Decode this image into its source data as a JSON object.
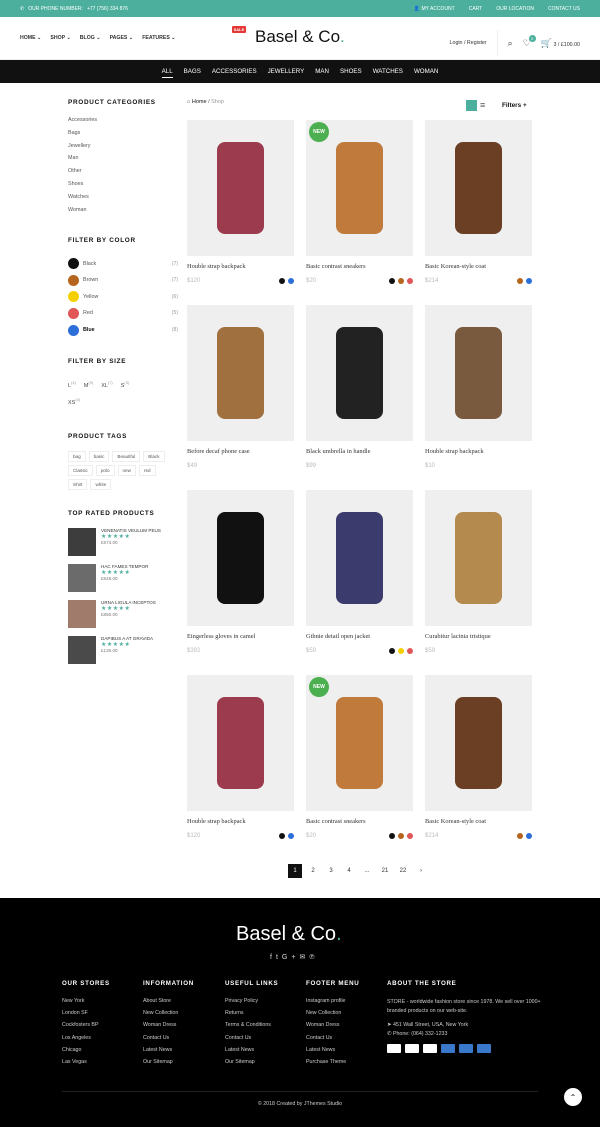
{
  "topbar": {
    "phone_label": "OUR PHONE NUMBER:",
    "phone_number": "+77 (756) 334 876",
    "my_account": "MY ACCOUNT",
    "cart": "CART",
    "our_location": "OUR LOCATION",
    "contact_us": "CONTACT US"
  },
  "nav": {
    "home": "HOME",
    "shop": "SHOP",
    "sale_badge": "SALE",
    "blog": "BLOG",
    "pages": "PAGES",
    "features": "FEATURES"
  },
  "logo": {
    "text": "Basel & Co",
    "dot": "."
  },
  "header_right": {
    "login": "Login / Register",
    "wishlist_count": "0",
    "cart_summary": "3 / £100.00"
  },
  "categories": [
    "ALL",
    "BAGS",
    "ACCESSORIES",
    "JEWELLERY",
    "MAN",
    "SHOES",
    "WATCHES",
    "WOMAN"
  ],
  "sidebar": {
    "product_categories_title": "PRODUCT CATEGORIES",
    "product_categories": [
      "Accessories",
      "Bags",
      "Jewellery",
      "Man",
      "Other",
      "Shoes",
      "Watches",
      "Woman"
    ],
    "filter_color_title": "FILTER BY COLOR",
    "colors": [
      {
        "name": "Black",
        "count": "(7)",
        "hex": "#111111"
      },
      {
        "name": "Brown",
        "count": "(7)",
        "hex": "#b5651d"
      },
      {
        "name": "Yellow",
        "count": "(6)",
        "hex": "#f5d000"
      },
      {
        "name": "Red",
        "count": "(5)",
        "hex": "#e05555"
      },
      {
        "name": "Blue",
        "count": "(8)",
        "hex": "#2d6fd8"
      }
    ],
    "filter_size_title": "FILTER BY SIZE",
    "sizes": [
      {
        "name": "L",
        "count": "(4)"
      },
      {
        "name": "M",
        "count": "(9)"
      },
      {
        "name": "XL",
        "count": "(7)"
      },
      {
        "name": "S",
        "count": "(3)"
      },
      {
        "name": "XS",
        "count": "(3)"
      }
    ],
    "tags_title": "PRODUCT TAGS",
    "tags": [
      "bag",
      "basic",
      "Beautiful",
      "Black",
      "Classic",
      "polo",
      "new",
      "red",
      "Shirt",
      "white"
    ],
    "top_rated_title": "TOP RATED PRODUCTS",
    "top_rated": [
      {
        "name": "VENENATIS VEULUM PEUS",
        "stars": "★★★★★",
        "price": "£574.00"
      },
      {
        "name": "HAC FAMES TEMPOR",
        "stars": "★★★★★",
        "price": "£545.00"
      },
      {
        "name": "URNA LIGULA INCEPTOS",
        "stars": "★★★★★",
        "price": "£850.00"
      },
      {
        "name": "DAPIBUS A AT GRAVIDA",
        "stars": "★★★★★",
        "price": "£125.00"
      }
    ]
  },
  "breadcrumb": {
    "home": "Home",
    "separator": "/",
    "current": "Shop"
  },
  "filters_label": "Filters",
  "products": [
    {
      "name": "Houble strap backpack",
      "price": "$120",
      "new": false,
      "colors": [
        "#111111",
        "#2d6fd8"
      ]
    },
    {
      "name": "Basic contrast sneakers",
      "price": "$20",
      "new": true,
      "colors": [
        "#111111",
        "#b5651d",
        "#e05555"
      ]
    },
    {
      "name": "Basic Korean-style coat",
      "price": "$214",
      "new": false,
      "colors": [
        "#b5651d",
        "#2d6fd8"
      ]
    },
    {
      "name": "Before decaf phone case",
      "price": "$49",
      "new": false,
      "colors": []
    },
    {
      "name": "Black umbrella in handle",
      "price": "$99",
      "new": false,
      "colors": []
    },
    {
      "name": "Houble strap backpack",
      "price": "$10",
      "new": false,
      "colors": []
    },
    {
      "name": "Eingerless gloves in camel",
      "price": "$392",
      "new": false,
      "colors": []
    },
    {
      "name": "Gthnie detail open jacket",
      "price": "$59",
      "new": false,
      "colors": [
        "#111111",
        "#f5d000",
        "#e05555"
      ]
    },
    {
      "name": "Curabitur lacinia tristique",
      "price": "$59",
      "new": false,
      "colors": []
    },
    {
      "name": "Houble strap backpack",
      "price": "$120",
      "new": false,
      "colors": [
        "#111111",
        "#2d6fd8"
      ]
    },
    {
      "name": "Basic contrast sneakers",
      "price": "$20",
      "new": true,
      "colors": [
        "#111111",
        "#b5651d",
        "#e05555"
      ]
    },
    {
      "name": "Basic Korean-style coat",
      "price": "$214",
      "new": false,
      "colors": [
        "#b5651d",
        "#2d6fd8"
      ]
    }
  ],
  "new_label": "NEW",
  "pagination": [
    "1",
    "2",
    "3",
    "4",
    "...",
    "21",
    "22"
  ],
  "footer": {
    "logo": "Basel & Co",
    "logo_dot": ".",
    "stores_title": "OUR STORES",
    "stores": [
      "New York",
      "London SF",
      "Cockfosters BP",
      "Los Angeles",
      "Chicago",
      "Las Vegas"
    ],
    "info_title": "INFORMATION",
    "info": [
      "About Store",
      "New Collection",
      "Woman Dress",
      "Contact Us",
      "Latest News",
      "Our Sitemap"
    ],
    "links_title": "USEFUL LINKS",
    "links": [
      "Privacy Policy",
      "Returns",
      "Terms & Conditions",
      "Contact Us",
      "Latest News",
      "Our Sitemap"
    ],
    "menu_title": "FOOTER MENU",
    "menu": [
      "Instagram profile",
      "New Collection",
      "Woman Dress",
      "Contact Us",
      "Latest News",
      "Purchase Theme"
    ],
    "about_title": "ABOUT THE STORE",
    "about_text": "STORE - worldwide fashion store since 1978. We sell over 1000+ branded products on our web-site.",
    "address": "451 Wall Street, USA, New York",
    "phone": "Phone: (064) 332-1233",
    "copyright": "© 2018 Created by JThemes Studio"
  }
}
